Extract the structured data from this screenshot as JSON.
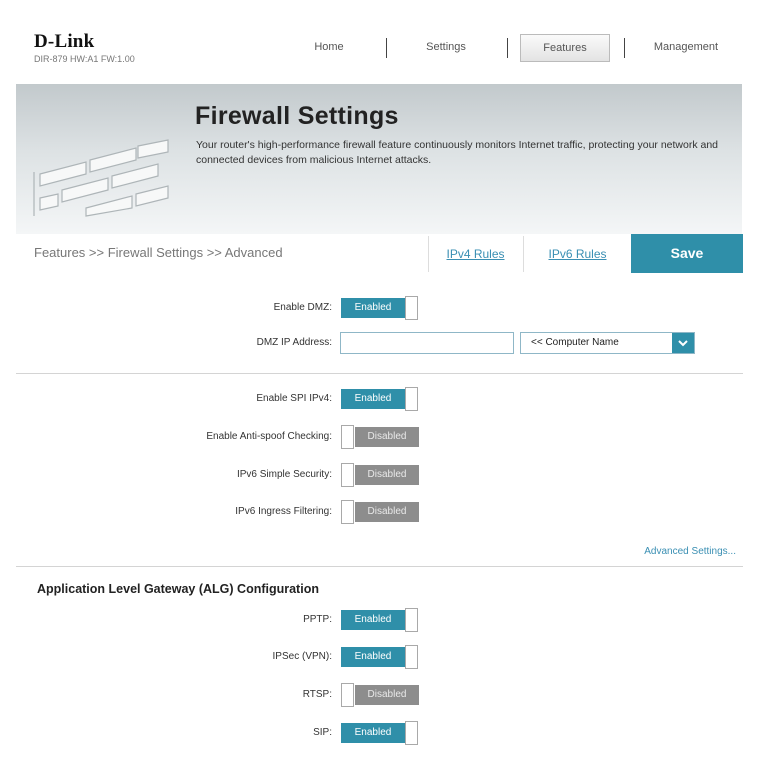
{
  "header": {
    "brand": "D-Link",
    "model": "DIR-879 HW:A1 FW:1.00",
    "nav": [
      "Home",
      "Settings",
      "Features",
      "Management"
    ],
    "active_nav": "Features"
  },
  "banner": {
    "title": "Firewall Settings",
    "description": "Your router's high-performance firewall feature continuously monitors Internet traffic, protecting your network and connected devices from malicious Internet attacks."
  },
  "breadcrumb": "Features >> Firewall Settings >> Advanced",
  "tabs": {
    "ipv4": "IPv4 Rules",
    "ipv6": "IPv6 Rules"
  },
  "save_label": "Save",
  "toggle_labels": {
    "enabled": "Enabled",
    "disabled": "Disabled"
  },
  "dmz": {
    "enable_label": "Enable DMZ:",
    "enable_state": "Enabled",
    "ip_label": "DMZ IP Address:",
    "ip_value": "",
    "computer_select": "<< Computer Name"
  },
  "firewall": {
    "spi_label": "Enable SPI IPv4:",
    "spi_state": "Enabled",
    "antispoof_label": "Enable Anti-spoof Checking:",
    "antispoof_state": "Disabled",
    "ipv6_simple_label": "IPv6 Simple Security:",
    "ipv6_simple_state": "Disabled",
    "ipv6_ingress_label": "IPv6 Ingress Filtering:",
    "ipv6_ingress_state": "Disabled"
  },
  "advanced_link": "Advanced Settings...",
  "alg": {
    "heading": "Application Level Gateway (ALG) Configuration",
    "pptp_label": "PPTP:",
    "pptp_state": "Enabled",
    "ipsec_label": "IPSec (VPN):",
    "ipsec_state": "Enabled",
    "rtsp_label": "RTSP:",
    "rtsp_state": "Disabled",
    "sip_label": "SIP:",
    "sip_state": "Enabled"
  },
  "colors": {
    "accent": "#2f8fa9",
    "disabled": "#8d8d8d",
    "link": "#3a8fb3"
  }
}
